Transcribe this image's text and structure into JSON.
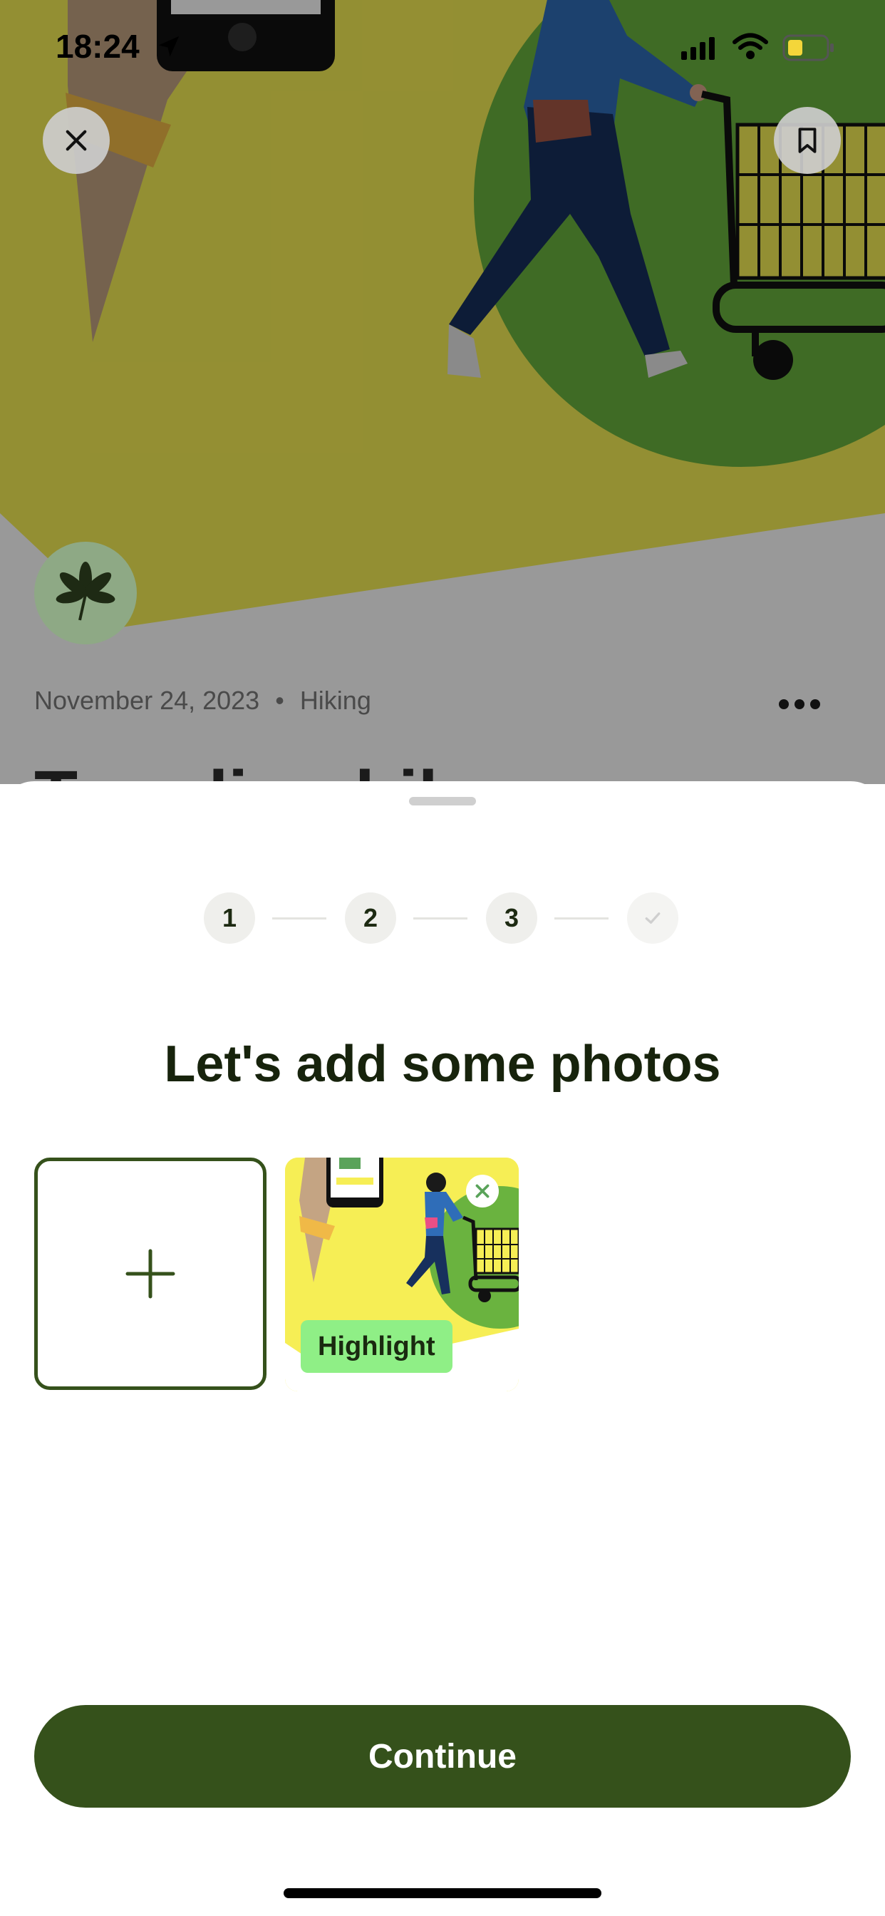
{
  "status_bar": {
    "time": "18:24",
    "icons": [
      "location-arrow-icon",
      "cellular-signal-icon",
      "wifi-icon",
      "battery-icon"
    ],
    "battery_color": "#f4d63a"
  },
  "background": {
    "date": "November 24, 2023",
    "separator": "•",
    "activity": "Hiking",
    "title_partial": "Trending hike",
    "colors": {
      "yellow": "#f6ee55",
      "green": "#6ab33f"
    }
  },
  "sheet": {
    "steps": [
      "1",
      "2",
      "3"
    ],
    "final_step_icon": "checkmark-icon",
    "heading": "Let's add some photos",
    "add_photo_icon": "plus-icon",
    "photo_badge": "Highlight",
    "continue_label": "Continue",
    "accent_color": "#35511b"
  }
}
